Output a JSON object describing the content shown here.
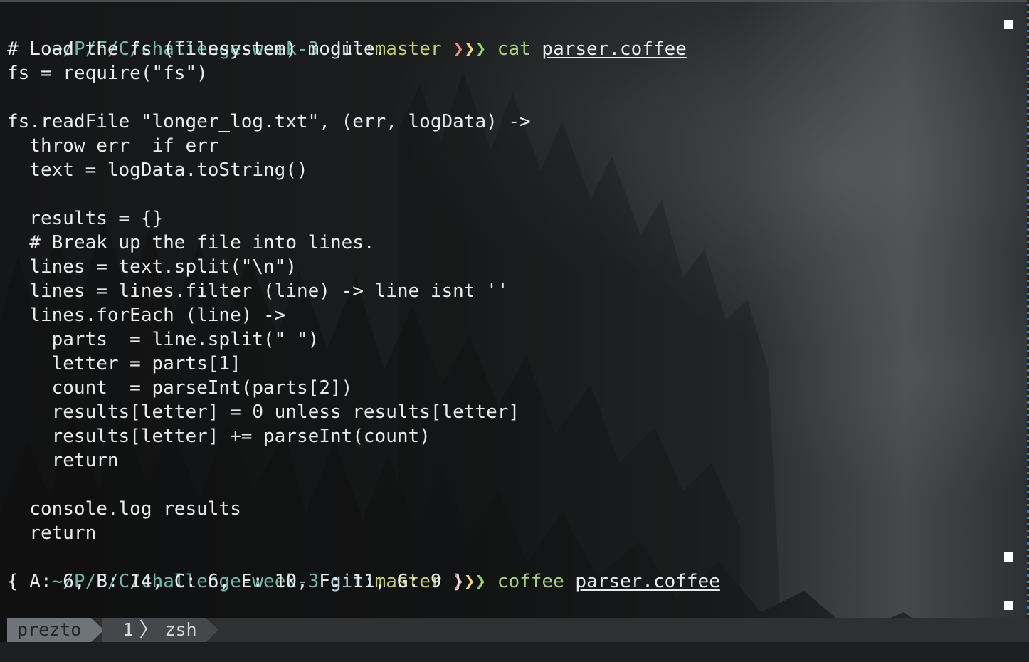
{
  "prompt": {
    "path": "~/P/F/C/challenge-week-3",
    "git_label": "git:",
    "branch": "master",
    "arrow_1": "❯",
    "arrow_2": "❯",
    "arrow_3": "❯"
  },
  "terminal": {
    "first_command": "cat",
    "first_file": "parser.coffee",
    "code_lines": [
      "# Load the fs (filesystem) module.",
      "fs = require(\"fs\")",
      "",
      "fs.readFile \"longer_log.txt\", (err, logData) ->",
      "  throw err  if err",
      "  text = logData.toString()",
      "",
      "  results = {}",
      "  # Break up the file into lines.",
      "  lines = text.split(\"\\n\")",
      "  lines = lines.filter (line) -> line isnt ''",
      "  lines.forEach (line) ->",
      "    parts  = line.split(\" \")",
      "    letter = parts[1]",
      "    count  = parseInt(parts[2])",
      "    results[letter] = 0 unless results[letter]",
      "    results[letter] += parseInt(count)",
      "    return",
      "",
      "  console.log results",
      "  return"
    ],
    "second_command": "coffee",
    "second_file": "parser.coffee",
    "output": "{ A: 6, B: 14, C: 6, E: 10, F: 11, G: 9 }"
  },
  "statusbar": {
    "session": "prezto",
    "window_index": "1",
    "window_separator": "〉",
    "window_name": "zsh"
  }
}
